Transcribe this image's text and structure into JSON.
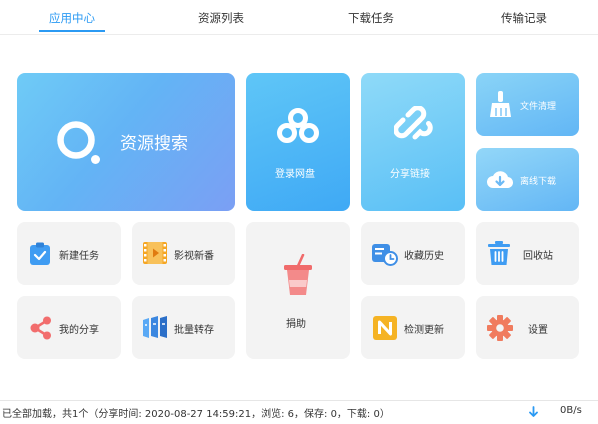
{
  "tabs": [
    {
      "label": "应用中心",
      "active": true
    },
    {
      "label": "资源列表",
      "active": false
    },
    {
      "label": "下载任务",
      "active": false
    },
    {
      "label": "传输记录",
      "active": false
    }
  ],
  "tiles": {
    "search": "资源搜索",
    "login": "登录网盘",
    "share_link": "分享链接",
    "file_clean": "文件清理",
    "offline_download": "离线下载",
    "new_task": "新建任务",
    "video": "影视新番",
    "donate": "捐助",
    "favorites_history": "收藏历史",
    "recycle_bin": "回收站",
    "my_share": "我的分享",
    "batch_save": "批量转存",
    "check_update": "检测更新",
    "settings": "设置"
  },
  "colors": {
    "accent": "#2b9af3",
    "tile_grey": "#f3f3f3"
  },
  "status": {
    "text": "已全部加载，共1个（分享时间: 2020-08-27 14:59:21，浏览: 6，保存: 0，下载: 0）",
    "speed": "0B/s"
  }
}
